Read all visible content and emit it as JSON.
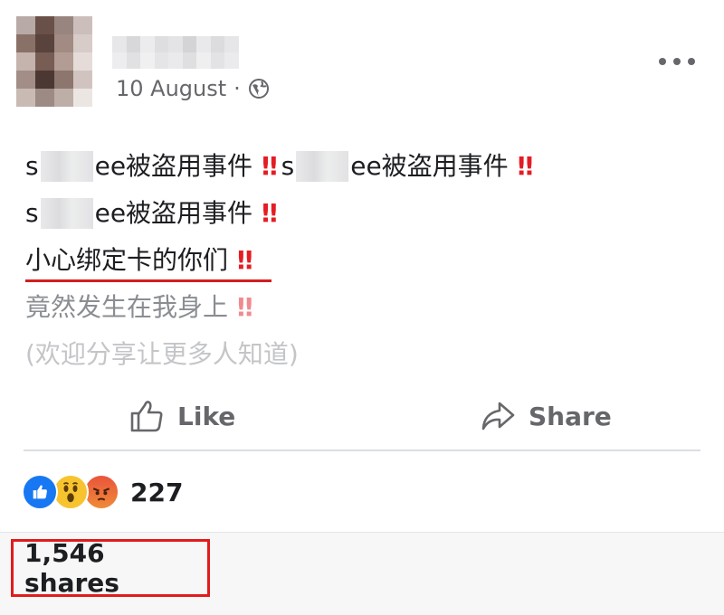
{
  "post": {
    "date": "10 August",
    "separator": "·",
    "privacy_icon": "globe-icon",
    "more_icon": "more-options-icon",
    "lines": [
      {
        "segments": [
          "s",
          "ee被盗用事件",
          "s",
          "ee被盗用事件"
        ],
        "bangs": "‼"
      },
      {
        "segments": [
          "s",
          "ee被盗用事件"
        ],
        "bangs": "‼"
      },
      {
        "text": "小心绑定卡的你们",
        "bangs": "‼"
      },
      {
        "text": "竟然发生在我身上",
        "bangs": "‼"
      },
      {
        "text": "(欢迎分享让更多人知道)"
      }
    ]
  },
  "actions": {
    "like_label": "Like",
    "share_label": "Share"
  },
  "reactions": {
    "icons": [
      "like-reaction-icon",
      "wow-reaction-icon",
      "angry-reaction-icon"
    ],
    "count": "227"
  },
  "shares": {
    "text": "1,546 shares"
  },
  "colors": {
    "accent_red": "#e21b1b",
    "like_blue": "#1877f2",
    "secondary_text": "#65676b"
  }
}
